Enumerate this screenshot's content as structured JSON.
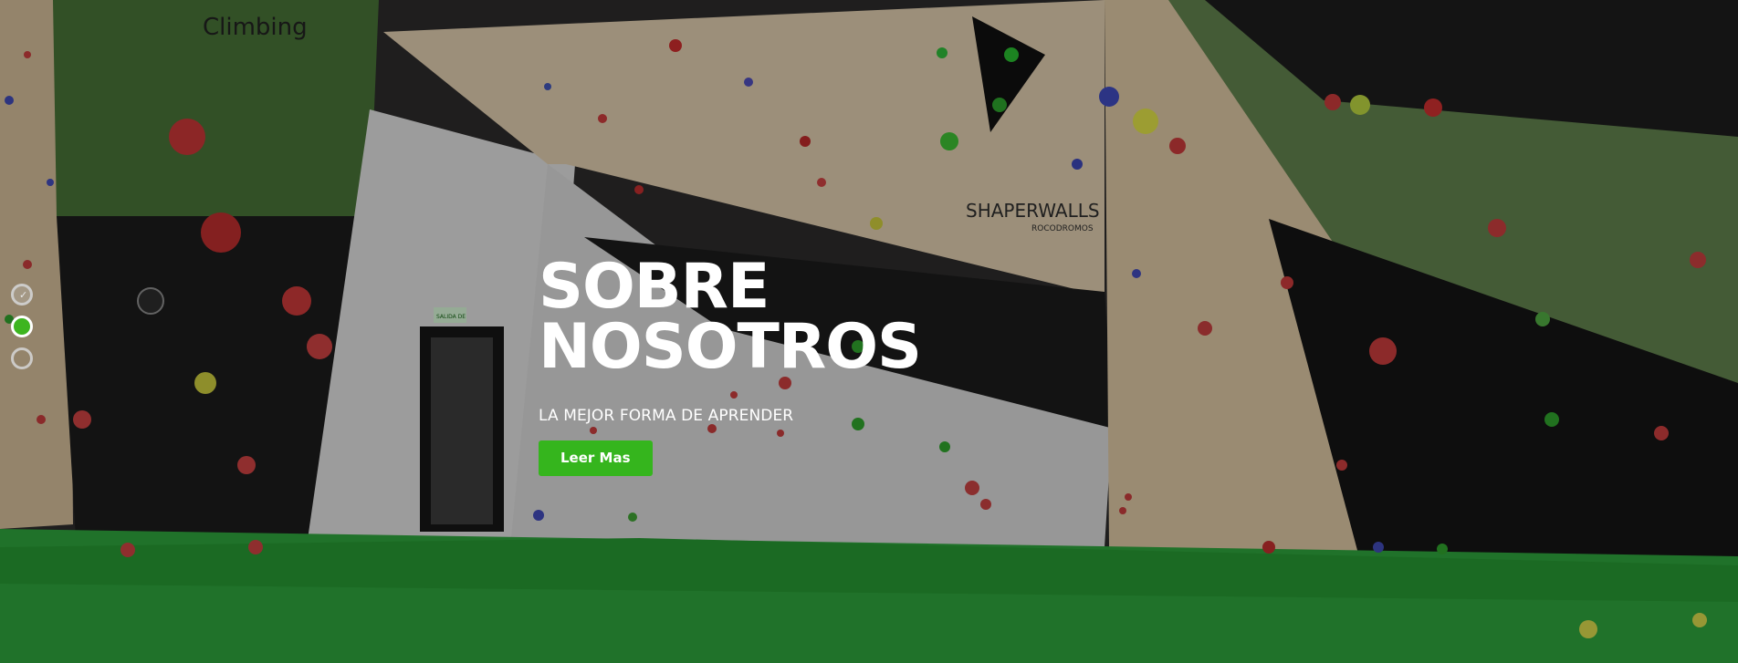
{
  "hero": {
    "title": "SOBRE NOSOTROS",
    "subtitle": "LA MEJOR FORMA DE APRENDER",
    "button_label": "Leer Mas"
  },
  "background": {
    "wall_sign": "SHAPERWALLS",
    "wall_sign_sub": "ROCODROMOS",
    "gym_logo": "Climbing",
    "door_sign": "SALIDA DE EMERGENCIA"
  },
  "slider": {
    "dots": [
      "dot-1",
      "dot-2",
      "dot-3"
    ],
    "active_index": 1
  },
  "colors": {
    "accent": "#35b51d",
    "mat": "#2aa13a",
    "wall": "#d7c2a3",
    "dark": "#1b1b1b"
  }
}
